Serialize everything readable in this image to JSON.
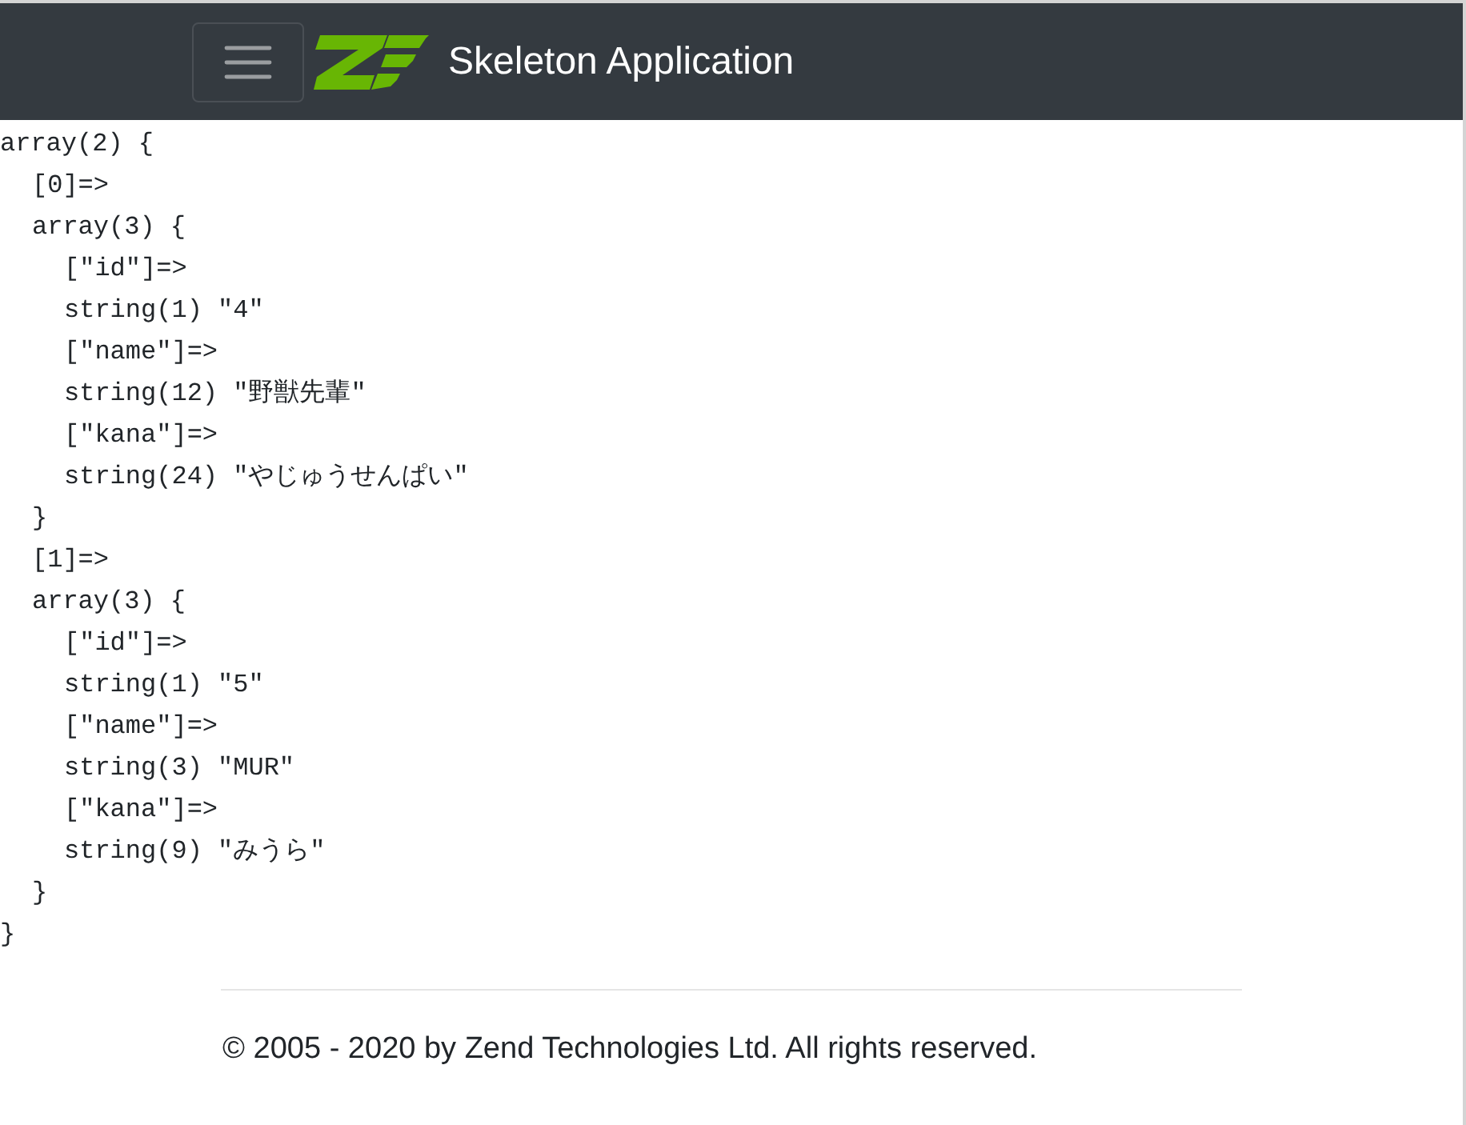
{
  "navbar": {
    "brand": "Skeleton Application"
  },
  "dump": {
    "line": "array(2) {",
    "children": [
      {
        "line": "[0]=>"
      },
      {
        "line": "array(3) {",
        "children": [
          {
            "line": "[\"id\"]=>"
          },
          {
            "line": "string(1) \"4\""
          },
          {
            "line": "[\"name\"]=>"
          },
          {
            "line": "string(12) \"野獣先輩\""
          },
          {
            "line": "[\"kana\"]=>"
          },
          {
            "line": "string(24) \"やじゅうせんぱい\""
          }
        ],
        "close": "}"
      },
      {
        "line": "[1]=>"
      },
      {
        "line": "array(3) {",
        "children": [
          {
            "line": "[\"id\"]=>"
          },
          {
            "line": "string(1) \"5\""
          },
          {
            "line": "[\"name\"]=>"
          },
          {
            "line": "string(3) \"MUR\""
          },
          {
            "line": "[\"kana\"]=>"
          },
          {
            "line": "string(9) \"みうら\""
          }
        ],
        "close": "}"
      }
    ],
    "close": "}"
  },
  "footer": {
    "copyright": "© 2005 - 2020 by Zend Technologies Ltd. All rights reserved."
  }
}
